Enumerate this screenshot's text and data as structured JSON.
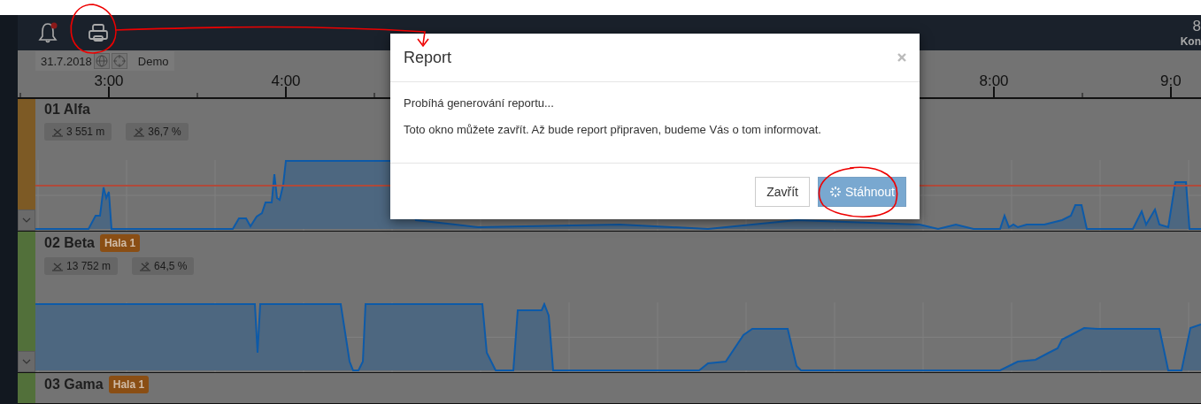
{
  "header": {
    "notifications": {
      "unread": true
    },
    "corner_texts": [
      "8",
      "Kon"
    ]
  },
  "toolbar": {
    "date": "31.7.2018",
    "mode": "Demo"
  },
  "time_axis": {
    "left_labels": [
      "3:00",
      "4:00"
    ],
    "right_labels": [
      "8:00",
      "9:0"
    ]
  },
  "machines": [
    {
      "name": "01 Alfa",
      "color": "#7d5a25",
      "stats": [
        "3 551 m",
        "36,7 %"
      ],
      "threshold_line": true
    },
    {
      "name": "02 Beta",
      "color": "#52703a",
      "badge": "Hala 1",
      "stats": [
        "13 752 m",
        "64,5 %"
      ],
      "threshold_line": false
    },
    {
      "name": "03 Gama",
      "color": "#52703a",
      "badge": "Hala 1"
    }
  ],
  "modal": {
    "title": "Report",
    "messages": [
      "Probíhá generování reportu...",
      "Toto okno můžete zavřít. Až bude report připraven, budeme Vás o tom informovat."
    ],
    "buttons": [
      {
        "label": "Zavřít",
        "kind": "secondary",
        "loading": false,
        "disabled": false
      },
      {
        "label": "Stáhnout",
        "kind": "primary",
        "loading": true,
        "disabled": true
      }
    ]
  }
}
